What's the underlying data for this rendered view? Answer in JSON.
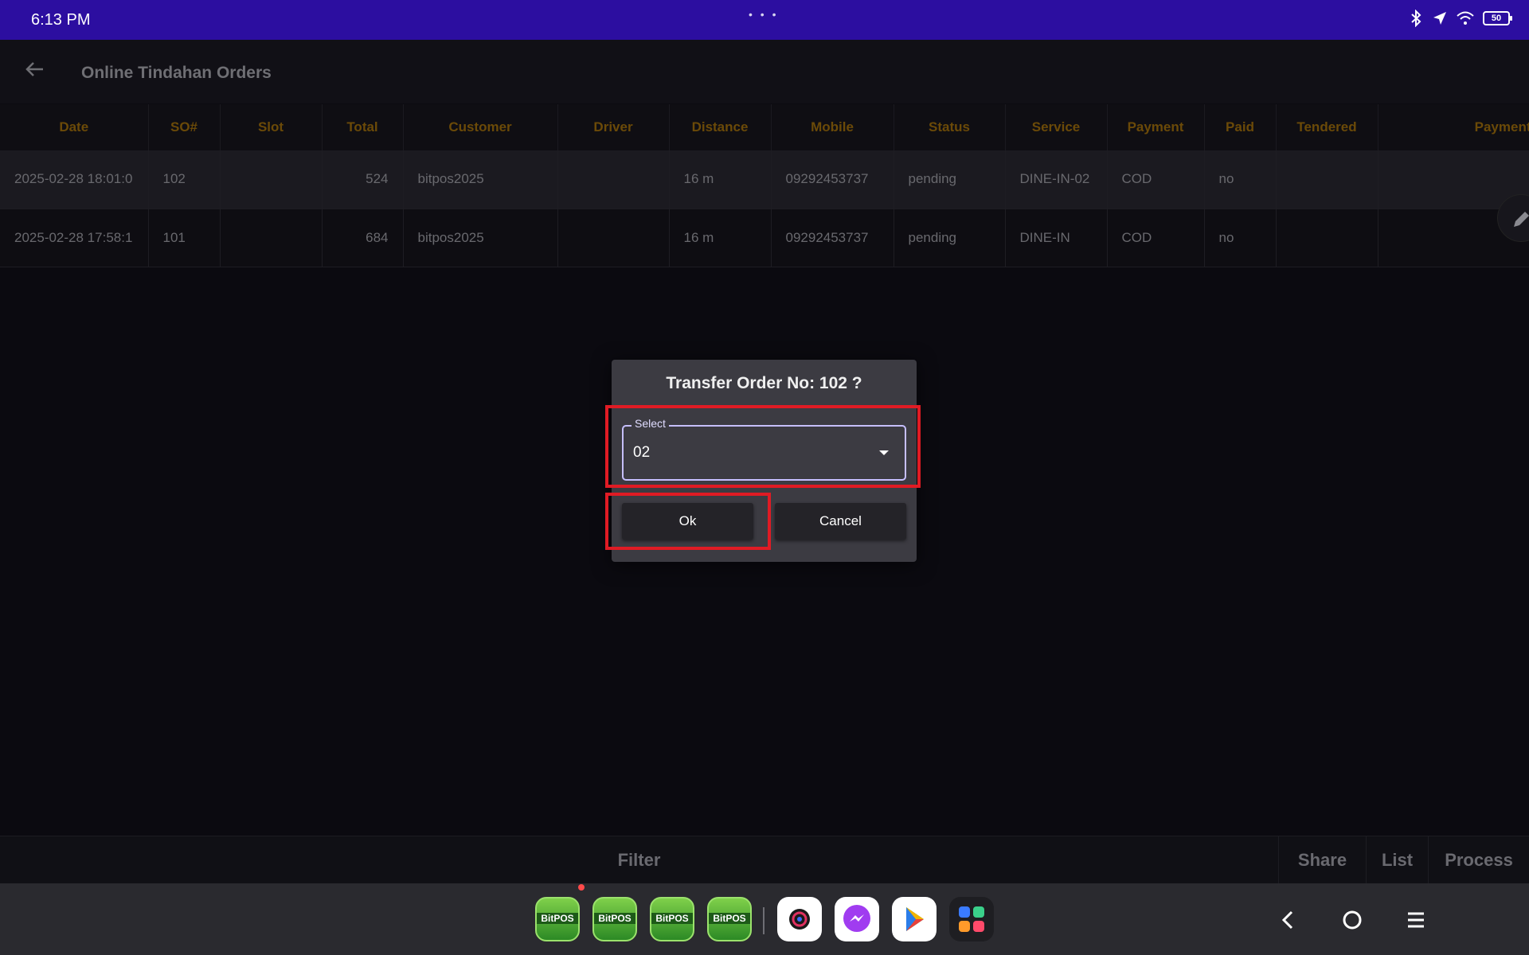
{
  "statusbar": {
    "time": "6:13 PM",
    "dots": "• • •",
    "battery": "50"
  },
  "appbar": {
    "title": "Online Tindahan Orders"
  },
  "table": {
    "columns": [
      "Date",
      "SO#",
      "Slot",
      "Total",
      "Customer",
      "Driver",
      "Distance",
      "Mobile",
      "Status",
      "Service",
      "Payment",
      "Paid",
      "Tendered",
      "Payment R"
    ],
    "rows": [
      {
        "date": "2025-02-28 18:01:0",
        "so": "102",
        "slot": "",
        "total": "524",
        "customer": "bitpos2025",
        "driver": "",
        "distance": "16 m",
        "mobile": "09292453737",
        "status": "pending",
        "service": "DINE-IN-02",
        "payment": "COD",
        "paid": "no",
        "tendered": "",
        "payment_r": ""
      },
      {
        "date": "2025-02-28 17:58:1",
        "so": "101",
        "slot": "",
        "total": "684",
        "customer": "bitpos2025",
        "driver": "",
        "distance": "16 m",
        "mobile": "09292453737",
        "status": "pending",
        "service": "DINE-IN",
        "payment": "COD",
        "paid": "no",
        "tendered": "",
        "payment_r": ""
      }
    ]
  },
  "bottombar": {
    "filter": "Filter",
    "share": "Share",
    "list": "List",
    "process": "Process"
  },
  "dock": {
    "apps": [
      "BitPOS",
      "BitPOS",
      "BitPOS",
      "BitPOS"
    ]
  },
  "dialog": {
    "title": "Transfer Order No: 102 ?",
    "select_label": "Select",
    "select_value": "02",
    "ok_label": "Ok",
    "cancel_label": "Cancel"
  },
  "colors": {
    "statusbar": "#2c0ea0",
    "highlight": "#e01b24",
    "header_text": "#6b4a08",
    "select_border": "#c6bfff"
  }
}
